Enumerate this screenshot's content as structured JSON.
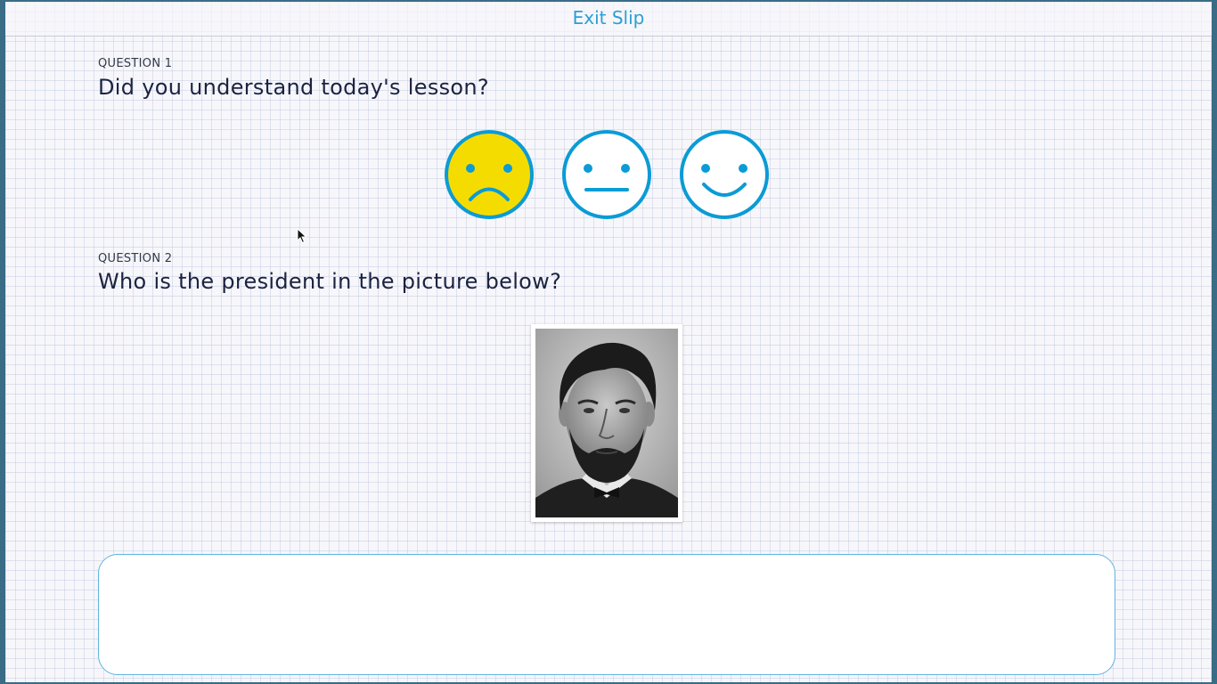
{
  "header": {
    "title": "Exit Slip"
  },
  "question1": {
    "label": "QUESTION 1",
    "text": "Did you understand today's lesson?",
    "options": [
      {
        "icon": "sad-face-icon",
        "selected": true
      },
      {
        "icon": "neutral-face-icon",
        "selected": false
      },
      {
        "icon": "happy-face-icon",
        "selected": false
      }
    ]
  },
  "question2": {
    "label": "QUESTION 2",
    "text": "Who is the president in the picture below?",
    "image_icon": "president-portrait-image",
    "answer_value": ""
  },
  "colors": {
    "accent": "#2a9fd6",
    "face_outline": "#0b9bd6",
    "selected_fill": "#f5dc00",
    "text_dark": "#1c2340"
  }
}
